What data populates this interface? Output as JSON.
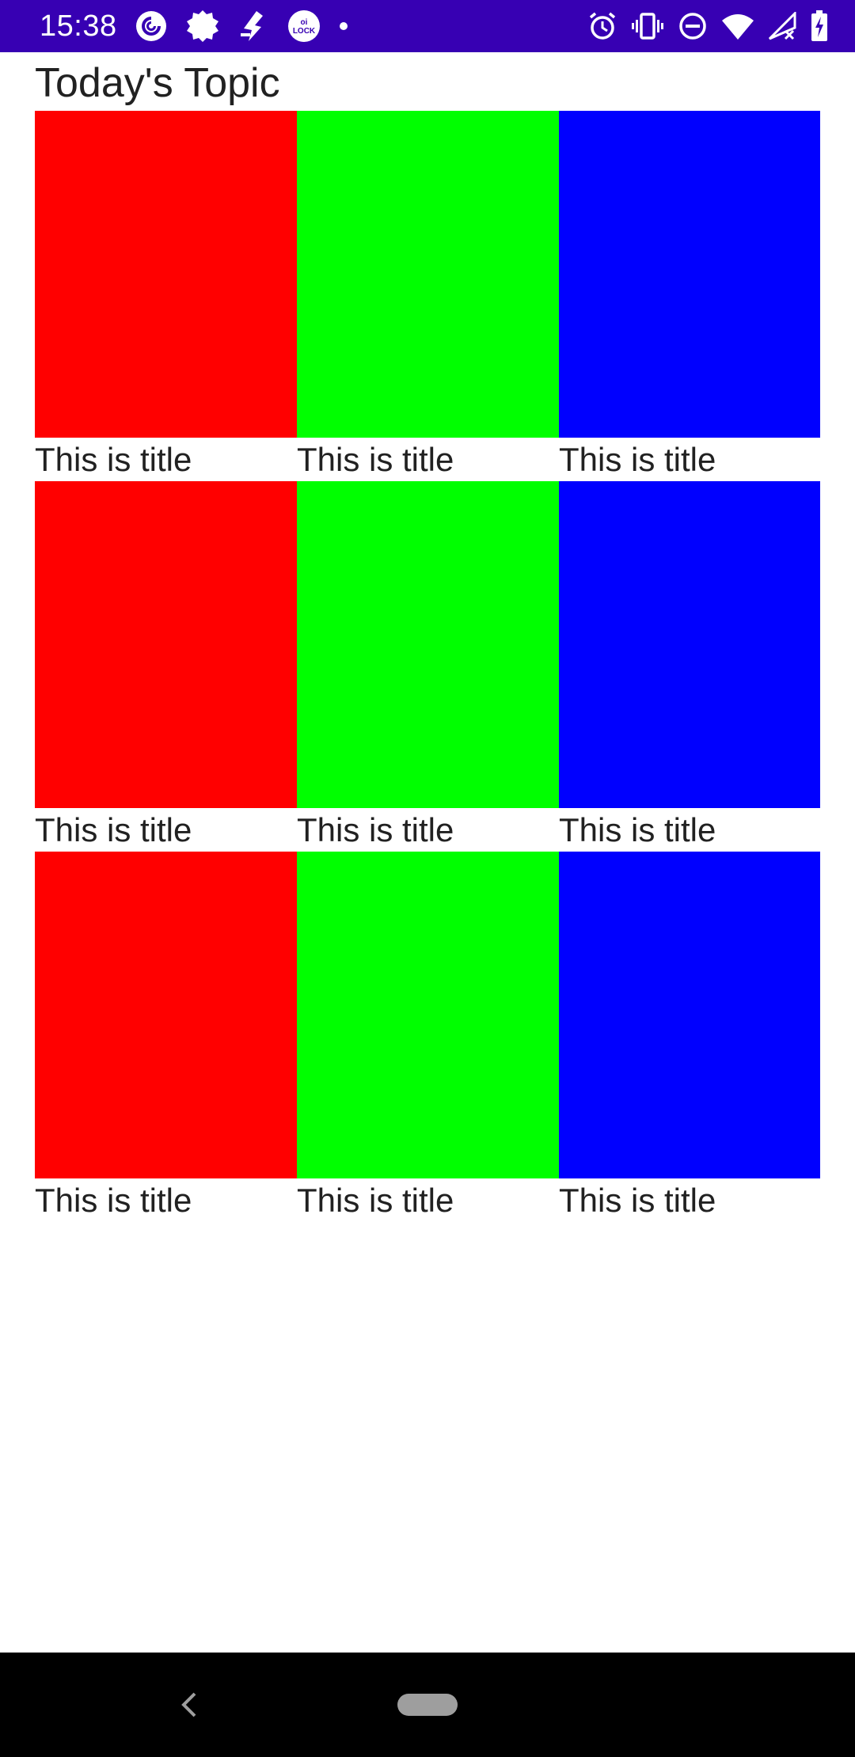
{
  "status_bar": {
    "time": "15:38",
    "background": "#3700B3",
    "left_icons": [
      "pocketcasts-icon",
      "settings-badge-icon",
      "fitness-app-icon",
      "oilock-icon",
      "notification-dot-icon"
    ],
    "right_icons": [
      "alarm-icon",
      "vibrate-icon",
      "do-not-disturb-icon",
      "wifi-icon",
      "no-signal-icon",
      "battery-charging-icon"
    ],
    "oilock_label": "oi LOCK"
  },
  "header": {
    "title": "Today's Topic"
  },
  "grid": {
    "rows": [
      [
        {
          "title": "This is title",
          "color": "#FF0000"
        },
        {
          "title": "This is title",
          "color": "#00FF00"
        },
        {
          "title": "This is title",
          "color": "#0000FF"
        }
      ],
      [
        {
          "title": "This is title",
          "color": "#FF0000"
        },
        {
          "title": "This is title",
          "color": "#00FF00"
        },
        {
          "title": "This is title",
          "color": "#0000FF"
        }
      ],
      [
        {
          "title": "This is title",
          "color": "#FF0000"
        },
        {
          "title": "This is title",
          "color": "#00FF00"
        },
        {
          "title": "This is title",
          "color": "#0000FF"
        }
      ]
    ]
  },
  "nav_bar": {
    "background": "#000000",
    "icons": [
      "back-icon",
      "home-pill-icon"
    ]
  }
}
